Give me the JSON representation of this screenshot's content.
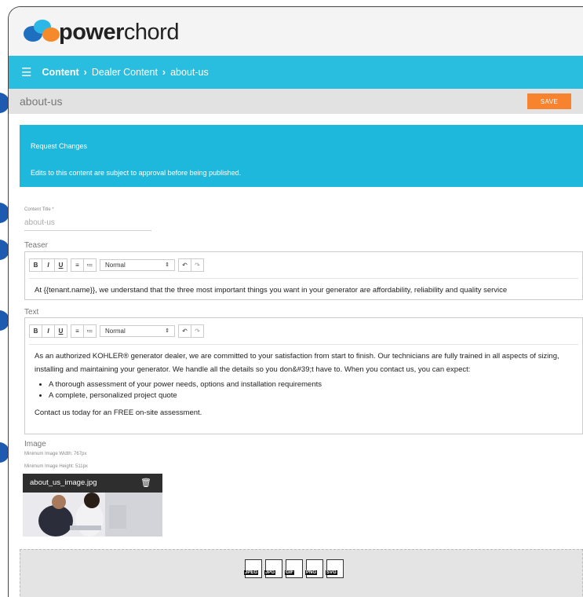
{
  "brand": {
    "logo_bold": "power",
    "logo_light": "chord"
  },
  "nav": {
    "section": "Content",
    "sub": "Dealer Content",
    "current": "about-us"
  },
  "page": {
    "title": "about-us",
    "save_label": "SAVE"
  },
  "notice": {
    "heading": "Request Changes",
    "body": "Edits to this content are subject to approval before being published."
  },
  "content_title": {
    "label": "Content Title *",
    "value": "about-us"
  },
  "teaser": {
    "label": "Teaser",
    "style": "Normal",
    "text": "At {{tenant.name}}, we understand that the three most important things you want in your generator are affordability, reliability and quality service"
  },
  "text_field": {
    "label": "Text",
    "style": "Normal",
    "para1": "As an authorized KOHLER® generator dealer, we are committed to your satisfaction from start to finish. Our technicians are fully trained in all aspects of sizing, installing and maintaining your generator. We handle all the details so you don&#39;t have to. When you contact us, you can expect:",
    "bullets": [
      "A thorough assessment of your power needs, options and installation requirements",
      "A complete, personalized project quote"
    ],
    "para2": "Contact us today for an FREE on-site assessment."
  },
  "image": {
    "label": "Image",
    "min_width": "Minimum Image Width: 767px",
    "min_height": "Minimum Image Height: 511px",
    "filename": "about_us_image.jpg"
  },
  "file_types": [
    "JPEG",
    "JPG",
    "GIF",
    "PNG",
    "SVG"
  ],
  "colors": {
    "nav": "#29bedf",
    "save": "#f7832f",
    "notice": "#1fb8dd"
  }
}
